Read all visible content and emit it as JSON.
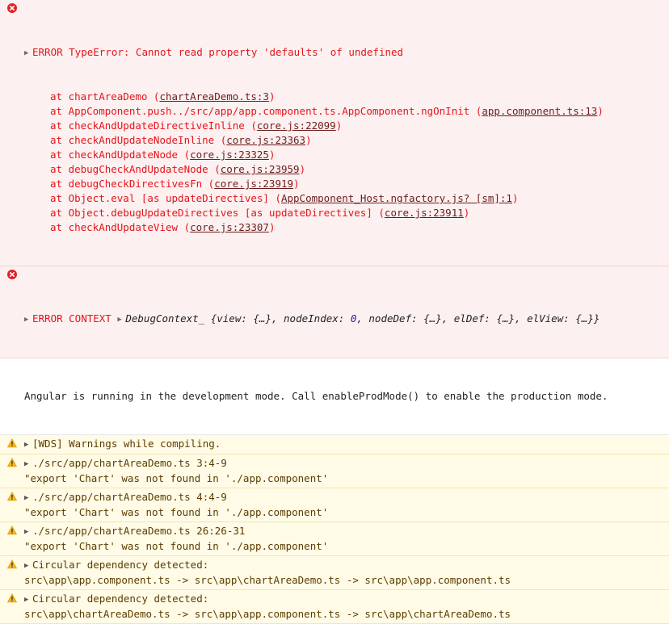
{
  "error1": {
    "head": "ERROR TypeError: Cannot read property 'defaults' of undefined",
    "stack": [
      {
        "pre": "at chartAreaDemo (",
        "link": "chartAreaDemo.ts:3",
        "post": ")"
      },
      {
        "pre": "at AppComponent.push../src/app/app.component.ts.AppComponent.ngOnInit (",
        "link": "app.component.ts:13",
        "post": ")"
      },
      {
        "pre": "at checkAndUpdateDirectiveInline (",
        "link": "core.js:22099",
        "post": ")"
      },
      {
        "pre": "at checkAndUpdateNodeInline (",
        "link": "core.js:23363",
        "post": ")"
      },
      {
        "pre": "at checkAndUpdateNode (",
        "link": "core.js:23325",
        "post": ")"
      },
      {
        "pre": "at debugCheckAndUpdateNode (",
        "link": "core.js:23959",
        "post": ")"
      },
      {
        "pre": "at debugCheckDirectivesFn (",
        "link": "core.js:23919",
        "post": ")"
      },
      {
        "pre": "at Object.eval [as updateDirectives] (",
        "link": "AppComponent_Host.ngfactory.js? [sm]:1",
        "post": ")"
      },
      {
        "pre": "at Object.debugUpdateDirectives [as updateDirectives] (",
        "link": "core.js:23911",
        "post": ")"
      },
      {
        "pre": "at checkAndUpdateView (",
        "link": "core.js:23307",
        "post": ")"
      }
    ]
  },
  "error2": {
    "label": "ERROR CONTEXT ",
    "ctx_name": "DebugContext_",
    "ctx_obj_a": " {view: {…}, nodeIndex: ",
    "ctx_num": "0",
    "ctx_obj_b": ", nodeDef: {…}, elDef: {…}, elView: {…}}"
  },
  "info": {
    "text": "Angular is running in the development mode. Call enableProdMode() to enable the production mode."
  },
  "warnings": [
    {
      "l1": "[WDS] Warnings while compiling.",
      "l2": ""
    },
    {
      "l1": "./src/app/chartAreaDemo.ts 3:4-9",
      "l2": "\"export 'Chart' was not found in './app.component'"
    },
    {
      "l1": "./src/app/chartAreaDemo.ts 4:4-9",
      "l2": "\"export 'Chart' was not found in './app.component'"
    },
    {
      "l1": "./src/app/chartAreaDemo.ts 26:26-31",
      "l2": "\"export 'Chart' was not found in './app.component'"
    },
    {
      "l1": "Circular dependency detected:",
      "l2": "src\\app\\app.component.ts -> src\\app\\chartAreaDemo.ts -> src\\app\\app.component.ts"
    },
    {
      "l1": "Circular dependency detected:",
      "l2": "src\\app\\chartAreaDemo.ts -> src\\app\\app.component.ts -> src\\app\\chartAreaDemo.ts"
    }
  ],
  "icons": {
    "error": "error-circle-icon",
    "warning": "warning-triangle-icon",
    "expand": "expand-triangle-icon"
  },
  "colors": {
    "error_text": "#e3151b",
    "error_bg": "#fdf0f0",
    "warn_bg": "#fffbe6",
    "warn_text": "#5c3c00"
  }
}
